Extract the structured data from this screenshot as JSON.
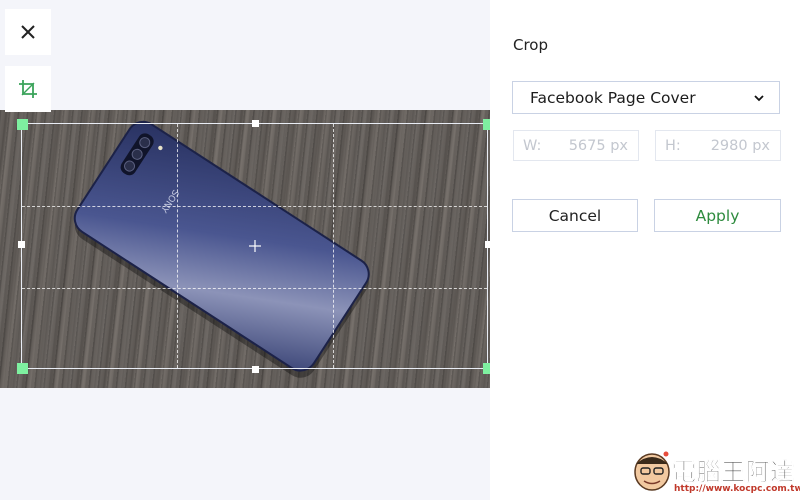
{
  "toolbar": {
    "close_icon": "close-icon",
    "crop_icon": "crop-icon"
  },
  "canvas": {
    "photo_brand_text": "SONY"
  },
  "panel": {
    "title": "Crop",
    "preset": {
      "selected": "Facebook Page Cover",
      "icon": "chevron-down-icon"
    },
    "width": {
      "label": "W:",
      "value": "5675 px"
    },
    "height": {
      "label": "H:",
      "value": "2980 px"
    },
    "cancel_label": "Cancel",
    "apply_label": "Apply"
  },
  "colors": {
    "accent_green": "#2e8b3e",
    "handle_green": "#7ef0a0",
    "border": "#c9d2e4"
  },
  "watermark": {
    "text": "電腦王阿達",
    "url": "http://www.kocpc.com.tw"
  }
}
